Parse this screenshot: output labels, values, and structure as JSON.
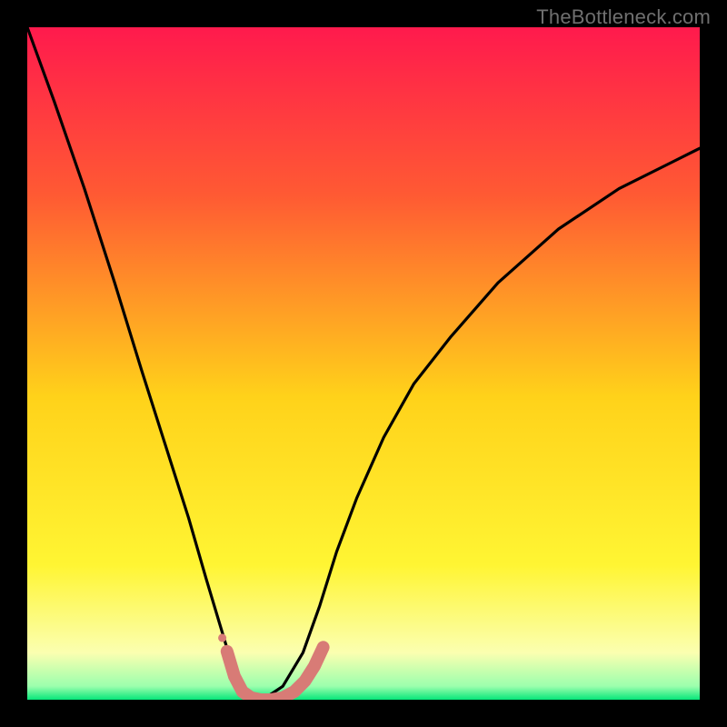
{
  "watermark": "TheBottleneck.com",
  "chart_data": {
    "type": "line",
    "title": "",
    "xlabel": "",
    "ylabel": "",
    "xlim": [
      0,
      1
    ],
    "ylim": [
      0,
      100
    ],
    "background_gradient_stops": [
      {
        "offset": 0.0,
        "color": "#ff1a4d"
      },
      {
        "offset": 0.25,
        "color": "#ff5a33"
      },
      {
        "offset": 0.55,
        "color": "#ffd21a"
      },
      {
        "offset": 0.8,
        "color": "#fff533"
      },
      {
        "offset": 0.93,
        "color": "#fbffb0"
      },
      {
        "offset": 0.98,
        "color": "#9bffad"
      },
      {
        "offset": 1.0,
        "color": "#06e67a"
      }
    ],
    "series": [
      {
        "name": "bottleneck_curve",
        "stroke": "#000000",
        "stroke_width_top": 3.2,
        "stroke_width_bottom": 1.6,
        "x": [
          0.0,
          0.04,
          0.085,
          0.13,
          0.17,
          0.205,
          0.24,
          0.266,
          0.29,
          0.305,
          0.32,
          0.335,
          0.35,
          0.38,
          0.41,
          0.435,
          0.46,
          0.49,
          0.53,
          0.575,
          0.63,
          0.7,
          0.79,
          0.88,
          0.96,
          1.0
        ],
        "y": [
          100,
          89,
          76,
          62,
          49,
          38,
          27,
          18,
          10,
          5,
          2,
          0,
          0,
          2,
          7,
          14,
          22,
          30,
          39,
          47,
          54,
          62,
          70,
          76,
          80,
          82
        ]
      },
      {
        "name": "bottom_marker",
        "stroke": "#d87b76",
        "stroke_width": 14,
        "linecap": "round",
        "marker": {
          "shape": "circle",
          "r": 7,
          "fill": "#d87b76"
        },
        "x": [
          0.297,
          0.308,
          0.32,
          0.333,
          0.347,
          0.362,
          0.38,
          0.397,
          0.413,
          0.427,
          0.44
        ],
        "y": [
          7.2,
          3.5,
          1.2,
          0.3,
          0.0,
          0.0,
          0.3,
          1.2,
          2.8,
          5.0,
          7.8
        ]
      }
    ]
  }
}
